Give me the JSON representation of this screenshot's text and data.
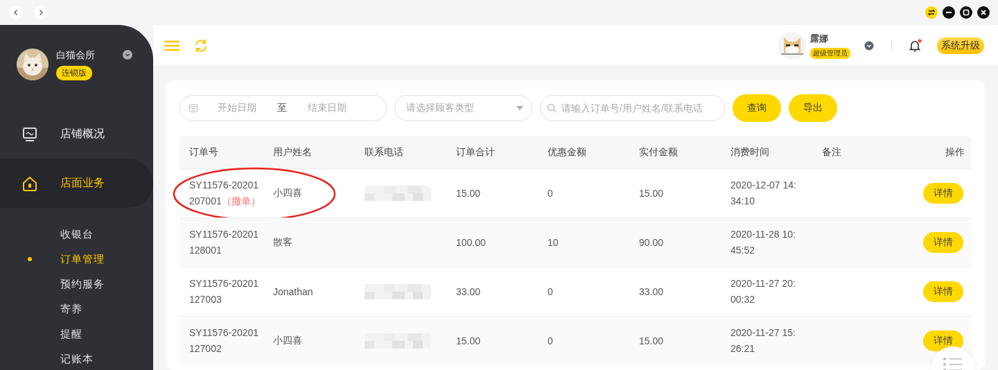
{
  "sidebar": {
    "shop_name": "白猫会所",
    "edition_badge": "连锁版",
    "items": [
      {
        "label": "店铺概况",
        "kind": "monitor",
        "selected": false
      },
      {
        "label": "店面业务",
        "kind": "house",
        "selected": true
      }
    ],
    "sub_items": [
      {
        "label": "收银台",
        "selected": false
      },
      {
        "label": "订单管理",
        "selected": true
      },
      {
        "label": "预约服务",
        "selected": false
      },
      {
        "label": "寄养",
        "selected": false
      },
      {
        "label": "提醒",
        "selected": false
      },
      {
        "label": "记账本",
        "selected": false
      }
    ]
  },
  "header": {
    "user_name": "露娜",
    "role_badge": "超级管理员",
    "notification_unread": true,
    "upgrade_button": "系统升级"
  },
  "filters": {
    "start_date_placeholder": "开始日期",
    "range_separator": "至",
    "end_date_placeholder": "结束日期",
    "customer_type_placeholder": "请选择顾客类型",
    "search_placeholder": "请输入订单号/用户姓名/联系电话",
    "query_button": "查询",
    "export_button": "导出"
  },
  "table": {
    "columns": [
      "订单号",
      "用户姓名",
      "联系电话",
      "订单合计",
      "优惠金额",
      "实付金额",
      "消费时间",
      "备注",
      "操作"
    ],
    "rows": [
      {
        "order_no": "SY11576-20201207001",
        "tag": "（撤单）",
        "circled": true,
        "user": "小四喜",
        "phone_masked": true,
        "total": "15.00",
        "discount": "0",
        "paid": "15.00",
        "time": "2020-12-07 14:34:10",
        "action": "详情"
      },
      {
        "order_no": "SY11576-20201128001",
        "circled": false,
        "user": "散客",
        "phone_masked": false,
        "total": "100.00",
        "discount": "10",
        "paid": "90.00",
        "time": "2020-11-28 10:45:52",
        "action": "详情"
      },
      {
        "order_no": "SY11576-20201127003",
        "circled": false,
        "user": "Jonathan",
        "phone_masked": true,
        "total": "33.00",
        "discount": "0",
        "paid": "33.00",
        "time": "2020-11-27 20:00:32",
        "action": "详情"
      },
      {
        "order_no": "SY11576-20201127002",
        "circled": false,
        "user": "小四喜",
        "phone_masked": true,
        "total": "15.00",
        "discount": "0",
        "paid": "15.00",
        "time": "2020-11-27 15:26:21",
        "action": "详情"
      }
    ]
  }
}
